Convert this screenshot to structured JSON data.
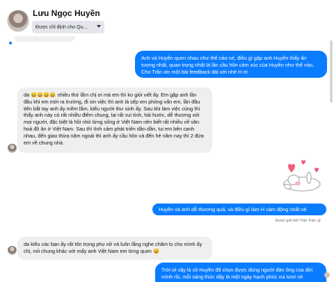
{
  "header": {
    "name": "Lưu Ngọc Huyền",
    "privacy_label": "Được chỉ định cho Qu..."
  },
  "messages": [
    {
      "side": "out",
      "text": "Anh và Huyền quen nhau như thế nào nè, điều gì gặp anh Huyền thấy ấn tượng nhất, quan trọng nhất là lần cầu hôn cảm xúc của Huyền như thế nào, Cho Trân xin một bài feedback dài với nhé H ơi"
    },
    {
      "side": "in",
      "text": "da 😄😄😄😄 nhiều thứ lắm chị ơi mà em thì ko giỏi viết ấy. Em gặp anh lần đầu khi em mới ra trường, đi xin việc thì anh là sếp em phỏng vấn em, lần đầu tiên bắt tay anh ấy mềm lắm, kiểu người thư sinh ấy. Sau khi làm việc cùng thì thấy anh này có rất nhiều điểm chung, lại rất vui tính, hài hước, dễ thương với mọi người, đặc biệt là hồi nhỏ từng sống ở Việt Nam nên biết rất nhiều về văn hoá đồ ăn ở Việt Nam. Sau thì tình cảm phát triển dần dần, tui em bên cạnh nhau, đến giao thừa năm ngoái thì anh ấy cầu hôn và đến hè năm nay thì 2 đứa em về chung nhà."
    },
    {
      "side": "out",
      "text": "Huyền và anh dễ thương quá, và điều gì làm H cảm động nhất nè"
    },
    {
      "side": "in",
      "text": "da kiểu các bạn ấy rất tôn trọng phụ nữ và luôn lắng nghe chăm lo cho mình ấy chị, nói chung khác với mấy anh Việt Nam em từng quen 😄"
    },
    {
      "side": "out",
      "text": "Trời ơi vậy là cô Huyền đã chọn được đúng người đàn ông của đời mình rồi, mỗi sáng thức dậy là một ngày hạnh phúc vui tươi nè"
    }
  ],
  "sent_meta": "Được gửi bởi Trân Trần",
  "colors": {
    "outgoing": "#0a7cff",
    "incoming": "#efefef"
  },
  "sticker": "heart-bunny-sticker"
}
